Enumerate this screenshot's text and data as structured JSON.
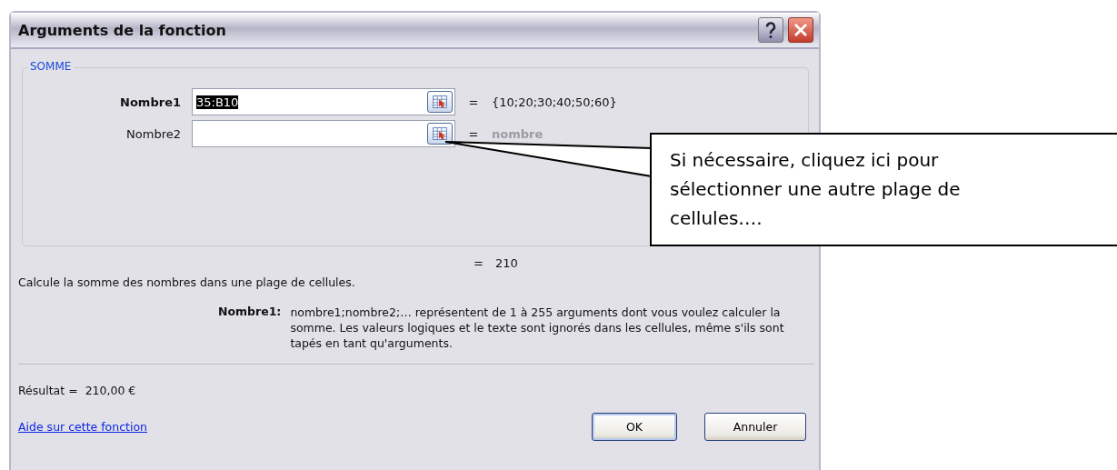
{
  "window": {
    "title": "Arguments de la fonction"
  },
  "function_group": {
    "name": "SOMME",
    "arguments": [
      {
        "label": "Nombre1",
        "active": true,
        "value": "35:B10",
        "value_selected": true,
        "equals": "=",
        "result": "{10;20;30;40;50;60}",
        "result_muted": false
      },
      {
        "label": "Nombre2",
        "active": false,
        "equals": "=",
        "result": "nombre",
        "result_muted": true
      }
    ]
  },
  "formula_result": {
    "equals": "=",
    "value": "210"
  },
  "description": "Calcule la somme des nombres dans une plage de cellules.",
  "argument_help": {
    "label": "Nombre1:",
    "text": "nombre1;nombre2;… représentent de 1 à 255 arguments dont vous voulez calculer la somme. Les valeurs logiques et le texte sont ignorés dans les cellules, même s'ils sont tapés en tant qu'arguments."
  },
  "result": {
    "label": "Résultat =",
    "value": "210,00 €"
  },
  "help_link": "Aide sur cette fonction",
  "buttons": [
    "OK",
    "Annuler"
  ],
  "callout": {
    "text": "Si nécessaire, cliquez ici pour sélectionner une autre plage de cellules…."
  }
}
